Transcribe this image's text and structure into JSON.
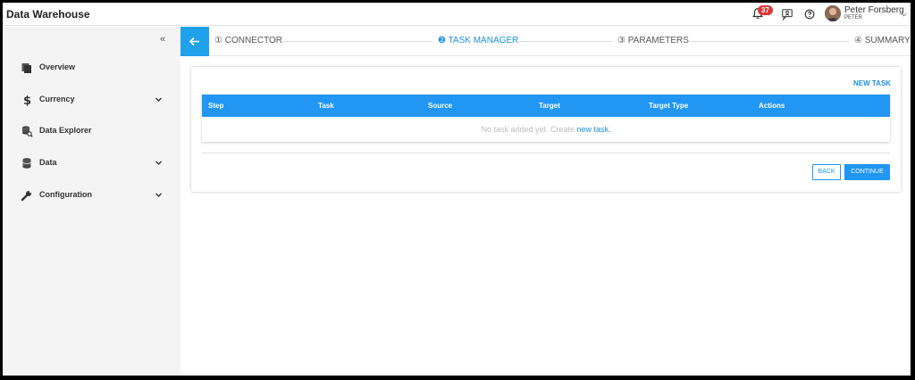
{
  "header": {
    "app_title": "Data Warehouse",
    "notification_count": "37",
    "user_name": "Peter Forsberg",
    "user_sub": "PETER"
  },
  "sidebar": {
    "items": [
      {
        "label": "Overview",
        "icon": "overview-icon",
        "has_children": false
      },
      {
        "label": "Currency",
        "icon": "dollar-icon",
        "has_children": true
      },
      {
        "label": "Data Explorer",
        "icon": "data-explorer-icon",
        "has_children": false
      },
      {
        "label": "Data",
        "icon": "database-icon",
        "has_children": true
      },
      {
        "label": "Configuration",
        "icon": "wrench-icon",
        "has_children": true
      }
    ]
  },
  "stepper": {
    "steps": [
      {
        "label": "① CONNECTOR",
        "active": false
      },
      {
        "label": "❷ TASK MANAGER",
        "active": true
      },
      {
        "label": "③ PARAMETERS",
        "active": false
      },
      {
        "label": "④ SUMMARY",
        "active": false
      }
    ]
  },
  "task_manager": {
    "new_task_label": "NEW TASK",
    "columns": [
      "Step",
      "Task",
      "Source",
      "Target",
      "Target Type",
      "Actions"
    ],
    "empty_text": "No task added yet. Create ",
    "empty_link": "new task.",
    "back_label": "BACK",
    "continue_label": "CONTINUE"
  },
  "colors": {
    "primary": "#2196f3",
    "stepper_back_bg": "#1fa1ec",
    "badge": "#d9383a",
    "sidebar_bg": "#f4f4f4"
  }
}
